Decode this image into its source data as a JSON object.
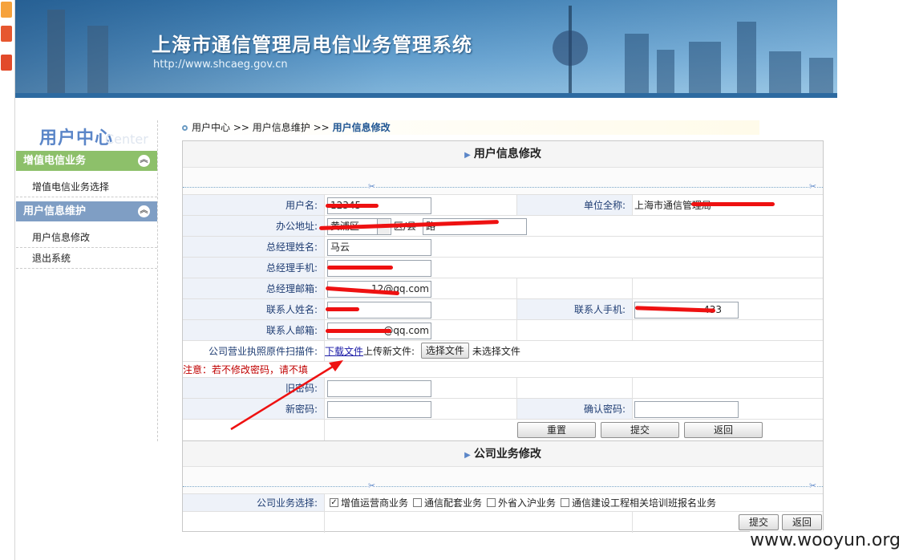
{
  "header": {
    "title": "上海市通信管理局电信业务管理系统",
    "url": "http://www.shcaeg.gov.cn"
  },
  "sidebar": {
    "logo": "用户中心",
    "logo_sub": "Center",
    "sections": [
      {
        "title": "增值电信业务",
        "color": "#8dc06a",
        "items": [
          "增值电信业务选择"
        ]
      },
      {
        "title": "用户信息维护",
        "color": "#7f9ec4",
        "items": [
          "用户信息修改",
          "退出系统"
        ]
      }
    ]
  },
  "breadcrumb": {
    "part1": "用户中心",
    "sep": ">>",
    "part2": "用户信息维护",
    "current": "用户信息修改"
  },
  "form1": {
    "title": "用户信息修改",
    "username_label": "用户名:",
    "username_value": "12345",
    "company_label": "单位全称:",
    "company_value": "上海市通信管理局",
    "address_label": "办公地址:",
    "district_value": "黄浦区",
    "district_suffix": "区/县",
    "street_value": "路",
    "gm_name_label": "总经理姓名:",
    "gm_name_value": "马云",
    "gm_phone_label": "总经理手机:",
    "gm_phone_value": "",
    "gm_email_label": "总经理邮箱:",
    "gm_email_value": "12@qq.com",
    "contact_name_label": "联系人姓名:",
    "contact_name_value": "",
    "contact_phone_label": "联系人手机:",
    "contact_phone_value": "433",
    "contact_email_label": "联系人邮箱:",
    "contact_email_value": "@qq.com",
    "license_label": "公司营业执照原件扫描件:",
    "download_label": "下载文件",
    "upload_label": "上传新文件:",
    "choose_file": "选择文件",
    "no_file": "未选择文件",
    "note": "注意：若不修改密码，请不填",
    "old_pwd_label": "旧密码:",
    "new_pwd_label": "新密码:",
    "confirm_pwd_label": "确认密码:",
    "reset_btn": "重置",
    "submit_btn": "提交",
    "back_btn": "返回"
  },
  "form2": {
    "title": "公司业务修改",
    "biz_label": "公司业务选择:",
    "options": [
      {
        "label": "增值运营商业务",
        "checked": true
      },
      {
        "label": "通信配套业务",
        "checked": false
      },
      {
        "label": "外省入沪业务",
        "checked": false
      },
      {
        "label": "通信建设工程相关培训班报名业务",
        "checked": false
      }
    ],
    "submit_btn": "提交",
    "back_btn": "返回"
  },
  "watermark": "www.wooyun.org",
  "colors": {
    "green_section": "#8dc06a",
    "blue_section": "#7f9ec4",
    "label_text": "#1f3d73",
    "note": "#c00000",
    "annotation": "#e11"
  }
}
